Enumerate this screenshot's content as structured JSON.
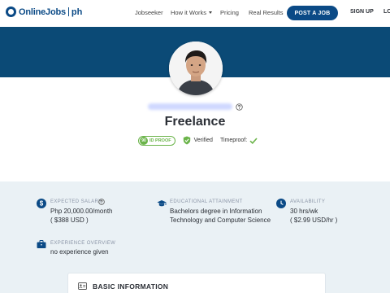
{
  "nav": {
    "logo_text": "OnlineJobs",
    "logo_suffix": "ph",
    "links": [
      "Jobseeker",
      "How it Works",
      "Pricing",
      "Real Results"
    ],
    "post_job_label": "POST A JOB",
    "signup_label": "SIGN UP",
    "login_label": "LO"
  },
  "profile": {
    "title": "Freelance",
    "idproof_score": "90",
    "idproof_label": "ID PROOF",
    "verified_label": "Verified",
    "timeproof_label": "Timeproof:"
  },
  "details": {
    "expected_salary": {
      "label": "EXPECTED SALARY",
      "value": "Php 20,000.00/month",
      "sub": "( $388 USD )"
    },
    "education": {
      "label": "EDUCATIONAL ATTAINMENT",
      "value": "Bachelors degree in Information Technology and Computer Science"
    },
    "availability": {
      "label": "AVAILABILITY",
      "value": "30 hrs/wk",
      "sub": "( $2.99 USD/hr )"
    },
    "experience": {
      "label": "EXPERIENCE OVERVIEW",
      "value": "no experience given"
    }
  },
  "basic_info": {
    "title": "BASIC INFORMATION"
  },
  "colors": {
    "brand": "#0b4a86",
    "banner": "#0b4a76",
    "verified_green": "#6bb44a",
    "details_bg": "#eaf1f5"
  }
}
